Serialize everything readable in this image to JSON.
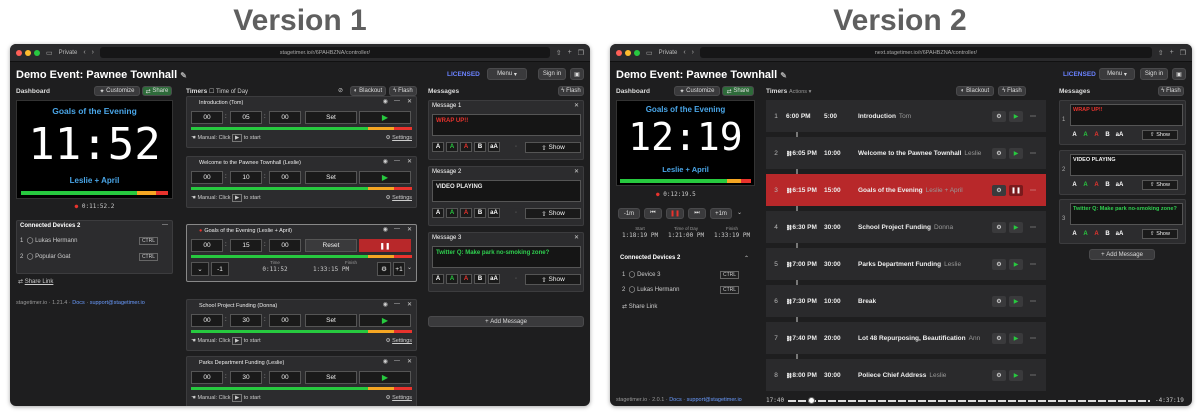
{
  "version1": {
    "title": "Version 1",
    "browser": {
      "private": "Private",
      "url": "stagetimer.io/r/6PAHBZNA/controller/"
    },
    "event_name": "Demo Event: Pawnee Townhall",
    "licensed": "LICENSED",
    "menu_label": "Menu",
    "signin_label": "Sign in",
    "dashboard_label": "Dashboard",
    "customize_label": "Customize",
    "share_label": "Share",
    "preview": {
      "title": "Goals of the Evening",
      "time": "11:52",
      "speaker": "Leslie + April",
      "elapsed": "0:11:52.2"
    },
    "devices_title": "Connected Devices 2",
    "devices": [
      {
        "num": "1",
        "name": "Lukas Hermann",
        "tag": "CTRL"
      },
      {
        "num": "2",
        "name": "Popular Goat",
        "tag": "CTRL"
      }
    ],
    "share_link": "Share Link",
    "footer": {
      "brand": "stagetimer.io",
      "version": "1.21.4",
      "docs": "Docs",
      "support": "support@stagetimer.io"
    },
    "timers_label": "Timers",
    "time_of_day": "Time of Day",
    "blackout": "Blackout",
    "flash": "Flash",
    "timers": [
      {
        "name": "Introduction (Tom)",
        "h": "00",
        "m": "05",
        "s": "00",
        "action": "Set",
        "manual": "Manual: Click",
        "to_start": "to start",
        "settings": "Settings"
      },
      {
        "name": "Welcome to the Pawnee Townhall (Leslie)",
        "h": "00",
        "m": "10",
        "s": "00",
        "action": "Set",
        "manual": "Manual: Click",
        "to_start": "to start",
        "settings": "Settings"
      },
      {
        "name": "Goals of the Evening (Leslie + April)",
        "h": "00",
        "m": "15",
        "s": "00",
        "action": "Reset",
        "minus": "-1",
        "plus": "+1",
        "time_label": "Time",
        "time_val": "0:11:52",
        "finish_label": "Finish",
        "finish_val": "1:33:15 PM"
      },
      {
        "name": "School Project Funding (Donna)",
        "h": "00",
        "m": "30",
        "s": "00",
        "action": "Set",
        "manual": "Manual: Click",
        "to_start": "to start",
        "settings": "Settings"
      },
      {
        "name": "Parks Department Funding (Leslie)",
        "h": "00",
        "m": "30",
        "s": "00",
        "action": "Set",
        "manual": "Manual: Click",
        "to_start": "to start",
        "settings": "Settings"
      }
    ],
    "messages_label": "Messages",
    "messages": [
      {
        "title": "Message 1",
        "text": "WRAP UP!!",
        "color": "#e8332d",
        "show": "Show"
      },
      {
        "title": "Message 2",
        "text": "VIDEO PLAYING",
        "color": "#eeeeee",
        "show": "Show"
      },
      {
        "title": "Message 3",
        "text": "Twitter Q: Make park no-smoking zone?",
        "color": "#2fcf4f",
        "show": "Show"
      }
    ],
    "add_message": "Add Message"
  },
  "version2": {
    "title": "Version 2",
    "browser": {
      "private": "Private",
      "url": "next.stagetimer.io/r/6PAHBZNA/controller/"
    },
    "event_name": "Demo Event: Pawnee Townhall",
    "licensed": "LICENSED",
    "menu_label": "Menu",
    "signin_label": "Sign in",
    "dashboard_label": "Dashboard",
    "customize_label": "Customize",
    "share_label": "Share",
    "preview": {
      "title": "Goals of the Evening",
      "time": "12:19",
      "speaker": "Leslie + April",
      "elapsed": "0:12:19.5"
    },
    "transport": {
      "minus": "-1m",
      "plus": "+1m"
    },
    "stats": [
      {
        "label": "Start",
        "value": "1:18:19 PM"
      },
      {
        "label": "Time of Day",
        "value": "1:21:00 PM"
      },
      {
        "label": "Finish",
        "value": "1:33:19 PM"
      }
    ],
    "devices_title": "Connected Devices 2",
    "devices": [
      {
        "num": "1",
        "name": "Device 3",
        "tag": "CTRL"
      },
      {
        "num": "2",
        "name": "Lukas Hermann",
        "tag": "CTRL"
      }
    ],
    "share_link": "Share Link",
    "footer": {
      "brand": "stagetimer.io",
      "version": "2.0.1",
      "docs": "Docs",
      "support": "support@stagetimer.io"
    },
    "timers_label": "Timers",
    "actions_label": "Actions",
    "blackout": "Blackout",
    "flash": "Flash",
    "rows": [
      {
        "num": "1",
        "start": "6:00 PM",
        "dur": "5:00",
        "title": "Introduction",
        "speaker": "Tom"
      },
      {
        "num": "2",
        "start": "6:05 PM",
        "dur": "10:00",
        "title": "Welcome to the Pawnee Townhall",
        "speaker": "Leslie"
      },
      {
        "num": "3",
        "start": "6:15 PM",
        "dur": "15:00",
        "title": "Goals of the Evening",
        "speaker": "Leslie + April"
      },
      {
        "num": "4",
        "start": "6:30 PM",
        "dur": "30:00",
        "title": "School Project Funding",
        "speaker": "Donna"
      },
      {
        "num": "5",
        "start": "7:00 PM",
        "dur": "30:00",
        "title": "Parks Department Funding",
        "speaker": "Leslie"
      },
      {
        "num": "6",
        "start": "7:30 PM",
        "dur": "10:00",
        "title": "Break",
        "speaker": ""
      },
      {
        "num": "7",
        "start": "7:40 PM",
        "dur": "20:00",
        "title": "Lot 48 Repurposing, Beautification",
        "speaker": "Ann"
      },
      {
        "num": "8",
        "start": "8:00 PM",
        "dur": "30:00",
        "title": "Poliece Chief Address",
        "speaker": "Leslie"
      }
    ],
    "timeline": {
      "left": "17:40",
      "right": "-4:37:19"
    },
    "messages_label": "Messages",
    "messages": [
      {
        "num": "1",
        "text": "WRAP UP!!",
        "color": "#e8332d",
        "show": "Show"
      },
      {
        "num": "2",
        "text": "VIDEO PLAYING",
        "color": "#eeeeee",
        "show": "Show"
      },
      {
        "num": "3",
        "text": "Twitter Q: Make park no-smoking zone?",
        "color": "#2fcf4f",
        "show": "Show"
      }
    ],
    "add_message": "Add Message"
  }
}
